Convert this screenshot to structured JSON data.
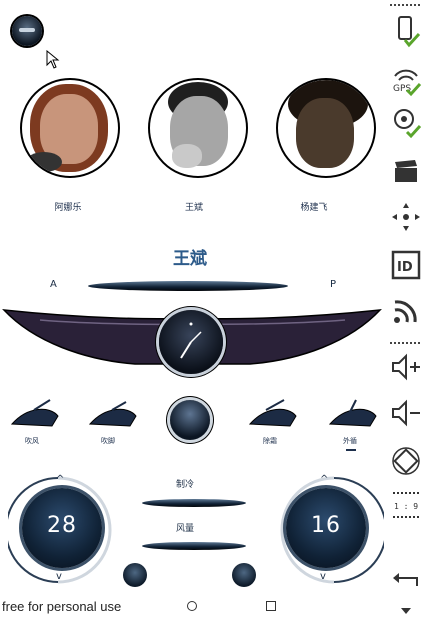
{
  "top_button": {
    "icon": "scroll-toggle-icon"
  },
  "contacts": [
    {
      "name": "阿娜乐",
      "skin": "#b9826a",
      "hair": "#7d3a20"
    },
    {
      "name": "王斌",
      "skin": "#a6a6a6",
      "hair": "#1f1f1f"
    },
    {
      "name": "杨建飞",
      "skin": "#4a3a2c",
      "hair": "#1c140e"
    }
  ],
  "selected_contact": "王斌",
  "range": {
    "left_label": "A",
    "right_label": "P"
  },
  "modes": [
    {
      "label": "吹风"
    },
    {
      "label": "吹脚"
    },
    {
      "label": "除霜"
    },
    {
      "label": "外循"
    }
  ],
  "climate": {
    "left_temp": "28",
    "right_temp": "16",
    "ac_label": "制冷",
    "fan_label": "风量"
  },
  "footer": {
    "watermark": "free for personal use",
    "nav_icons": [
      "circle-icon",
      "square-icon"
    ]
  },
  "sidebar": {
    "side_time": "1 : 9"
  },
  "colors": {
    "accent": "#1d2f4c",
    "dark": "#0d1726",
    "wing": "#2a2138"
  }
}
